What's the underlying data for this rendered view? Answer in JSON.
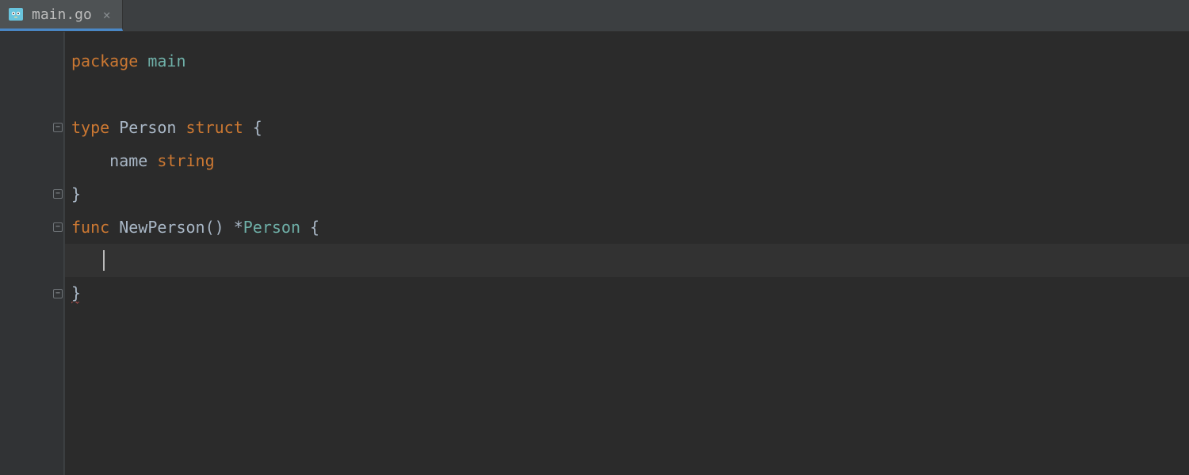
{
  "tab": {
    "filename": "main.go",
    "icon_name": "go-file-icon"
  },
  "code": {
    "lines": [
      {
        "indent": 0,
        "fold": null,
        "current": false,
        "segments": [
          {
            "cls": "tok-kw",
            "text": "package"
          },
          {
            "cls": "tok-pln",
            "text": " "
          },
          {
            "cls": "tok-type",
            "text": "main"
          }
        ]
      },
      {
        "indent": 0,
        "fold": null,
        "current": false,
        "segments": []
      },
      {
        "indent": 0,
        "fold": "open",
        "current": false,
        "segments": [
          {
            "cls": "tok-kw",
            "text": "type"
          },
          {
            "cls": "tok-pln",
            "text": " "
          },
          {
            "cls": "tok-id",
            "text": "Person"
          },
          {
            "cls": "tok-pln",
            "text": " "
          },
          {
            "cls": "tok-kw",
            "text": "struct"
          },
          {
            "cls": "tok-pln",
            "text": " {"
          }
        ]
      },
      {
        "indent": 1,
        "fold": null,
        "current": false,
        "segments": [
          {
            "cls": "tok-id",
            "text": "name"
          },
          {
            "cls": "tok-pln",
            "text": " "
          },
          {
            "cls": "tok-kw",
            "text": "string"
          }
        ]
      },
      {
        "indent": 0,
        "fold": "close",
        "current": false,
        "segments": [
          {
            "cls": "tok-pln",
            "text": "}"
          }
        ]
      },
      {
        "indent": 0,
        "fold": "open",
        "current": false,
        "segments": [
          {
            "cls": "tok-kw",
            "text": "func"
          },
          {
            "cls": "tok-pln",
            "text": " "
          },
          {
            "cls": "tok-id",
            "text": "NewPerson"
          },
          {
            "cls": "tok-pln",
            "text": "() *"
          },
          {
            "cls": "tok-type",
            "text": "Person"
          },
          {
            "cls": "tok-pln",
            "text": " {"
          }
        ]
      },
      {
        "indent": 0,
        "fold": null,
        "current": true,
        "caret": true,
        "segments": []
      },
      {
        "indent": 0,
        "fold": "close",
        "current": false,
        "error": true,
        "segments": [
          {
            "cls": "tok-pln",
            "text": "}"
          }
        ]
      }
    ]
  }
}
